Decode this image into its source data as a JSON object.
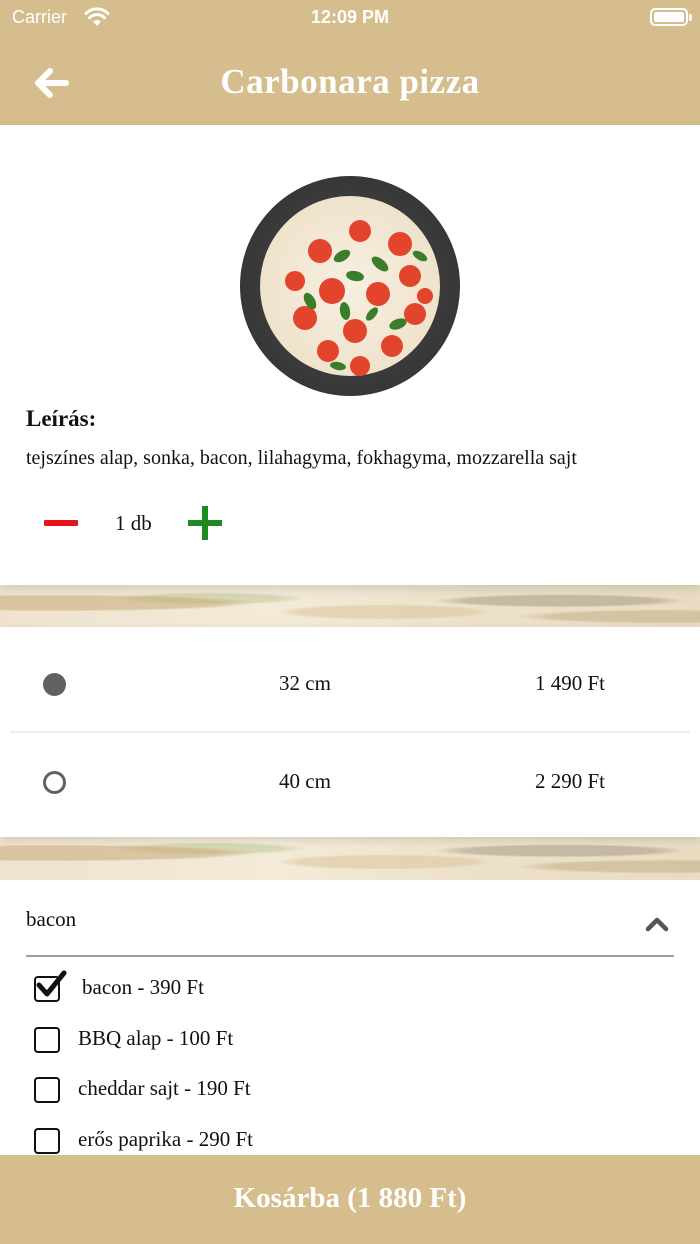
{
  "status_bar": {
    "carrier": "Carrier",
    "time": "12:09 PM"
  },
  "nav": {
    "title": "Carbonara pizza",
    "back_icon": "arrow-left-icon"
  },
  "product": {
    "description_label": "Leírás:",
    "description": "tejszínes alap, sonka, bacon, lilahagyma, fokhagyma, mozzarella sajt",
    "quantity": "1 db"
  },
  "sizes": [
    {
      "size": "32 cm",
      "price": "1 490 Ft",
      "selected": true
    },
    {
      "size": "40 cm",
      "price": "2 290 Ft",
      "selected": false
    }
  ],
  "extras": {
    "header": "bacon",
    "options": [
      {
        "label": "bacon - 390 Ft",
        "checked": true
      },
      {
        "label": "BBQ alap - 100 Ft",
        "checked": false
      },
      {
        "label": "cheddar sajt - 190 Ft",
        "checked": false
      },
      {
        "label": "erős paprika - 290 Ft",
        "checked": false
      }
    ]
  },
  "cart_button": "Kosárba (1 880 Ft)",
  "colors": {
    "brand": "#d6bd8e",
    "minus": "#e8141c",
    "plus": "#1f8a1f",
    "radio": "#616161"
  }
}
